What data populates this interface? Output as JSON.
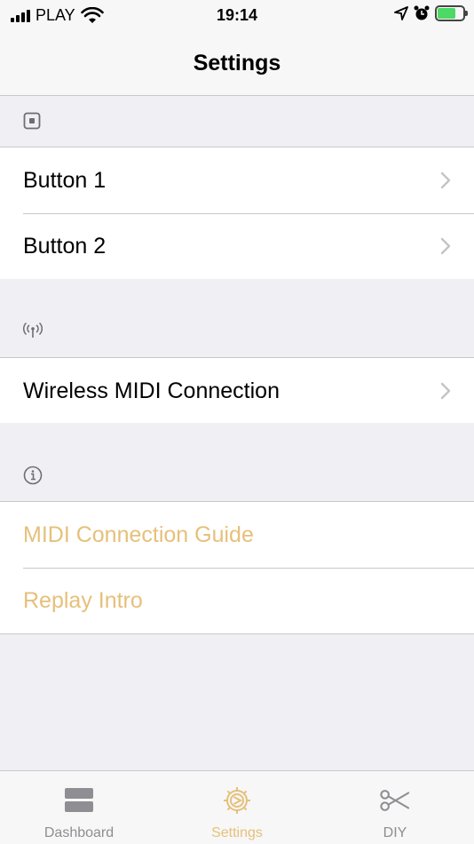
{
  "status_bar": {
    "carrier": "PLAY",
    "time": "19:14"
  },
  "nav": {
    "title": "Settings"
  },
  "sections": [
    {
      "header_icon": "button-icon",
      "rows": [
        {
          "label": "Button 1",
          "chevron": true
        },
        {
          "label": "Button 2",
          "chevron": true
        }
      ]
    },
    {
      "header_icon": "wireless-icon",
      "rows": [
        {
          "label": "Wireless MIDI Connection",
          "chevron": true
        }
      ]
    },
    {
      "header_icon": "info-icon",
      "rows": [
        {
          "label": "MIDI Connection Guide",
          "chevron": false
        },
        {
          "label": "Replay Intro",
          "chevron": false
        }
      ]
    }
  ],
  "tab_bar": {
    "tabs": [
      {
        "label": "Dashboard",
        "icon": "dashboard-icon",
        "active": false
      },
      {
        "label": "Settings",
        "icon": "settings-icon",
        "active": true
      },
      {
        "label": "DIY",
        "icon": "scissors-icon",
        "active": false
      }
    ]
  },
  "colors": {
    "accent": "#e6c07a",
    "background": "#efeff4",
    "separator": "#c8c7cc",
    "inactive_tab": "#8e8e93"
  }
}
